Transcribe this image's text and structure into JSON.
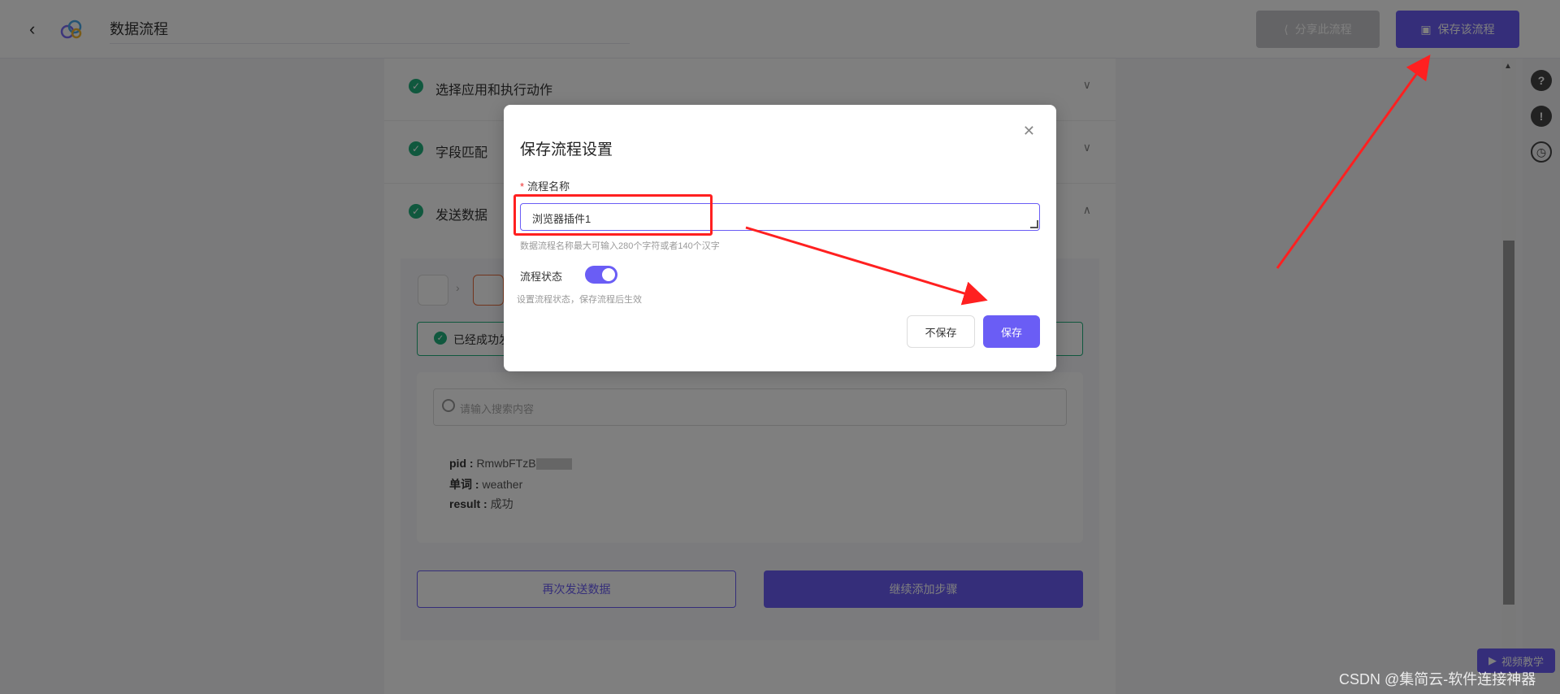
{
  "header": {
    "back_icon": "chevron-left-icon",
    "title": "数据流程",
    "share_label": "分享此流程",
    "save_flow_label": "保存该流程"
  },
  "rail": {
    "icons": [
      "help-icon",
      "alert-icon",
      "clock-icon"
    ]
  },
  "steps": [
    {
      "label": "选择应用和执行动作"
    },
    {
      "label": "字段匹配"
    },
    {
      "label": "发送数据"
    }
  ],
  "send": {
    "success_text": "已经成功发",
    "search_placeholder": "请输入搜索内容",
    "result": {
      "pid_key": "pid :",
      "pid_value": "RmwbFTzB",
      "word_key": "单词 :",
      "word_value": "weather",
      "result_key": "result :",
      "result_value": "成功"
    },
    "resend_label": "再次发送数据",
    "continue_label": "继续添加步骤"
  },
  "video_tutorial": "视频教学",
  "modal": {
    "title": "保存流程设置",
    "name_label": "流程名称",
    "name_value": "浏览器插件1",
    "name_hint": "数据流程名称最大可输入280个字符或者140个汉字",
    "status_label": "流程状态",
    "status_on": true,
    "status_hint": "设置流程状态，保存流程后生效",
    "nosave_label": "不保存",
    "save_label": "保存"
  },
  "watermark": "CSDN @集简云-软件连接神器",
  "colors": {
    "accent": "#6a5df5",
    "success": "#21b17d",
    "annotation": "#ff2020"
  }
}
